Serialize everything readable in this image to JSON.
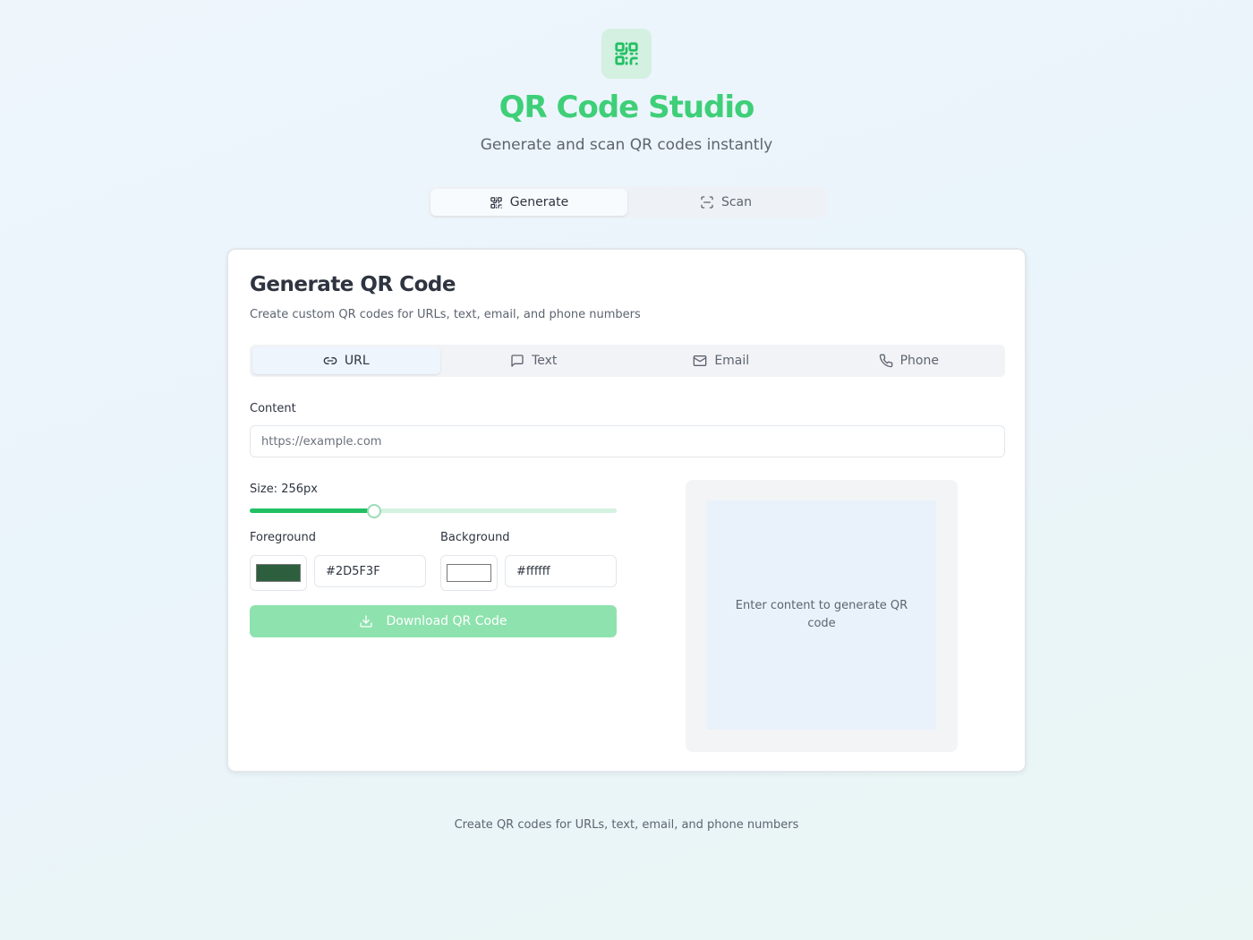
{
  "app": {
    "title": "QR Code Studio",
    "subtitle": "Generate and scan QR codes instantly",
    "logo_icon": "qr-code-icon"
  },
  "mode_tabs": [
    {
      "label": "Generate",
      "icon": "qr-code-icon",
      "active": true
    },
    {
      "label": "Scan",
      "icon": "scan-icon",
      "active": false
    }
  ],
  "card": {
    "title": "Generate QR Code",
    "description": "Create custom QR codes for URLs, text, email, and phone numbers",
    "type_tabs": [
      {
        "label": "URL",
        "icon": "link-icon",
        "active": true
      },
      {
        "label": "Text",
        "icon": "message-icon",
        "active": false
      },
      {
        "label": "Email",
        "icon": "mail-icon",
        "active": false
      },
      {
        "label": "Phone",
        "icon": "phone-icon",
        "active": false
      }
    ],
    "content": {
      "label": "Content",
      "placeholder": "https://example.com",
      "value": ""
    },
    "size": {
      "label": "Size: 256px",
      "value_fraction": 0.34
    },
    "foreground": {
      "label": "Foreground",
      "color": "#2D5F3F",
      "value": "#2D5F3F"
    },
    "background": {
      "label": "Background",
      "color": "#ffffff",
      "value": "#ffffff"
    },
    "download_label": "Download QR Code",
    "preview_placeholder": "Enter content to generate QR code"
  },
  "footer": "Create QR codes for URLs, text, email, and phone numbers",
  "colors": {
    "accent": "#3ecf78",
    "slider": "#22c063",
    "download_button": "#8ee2ae"
  }
}
